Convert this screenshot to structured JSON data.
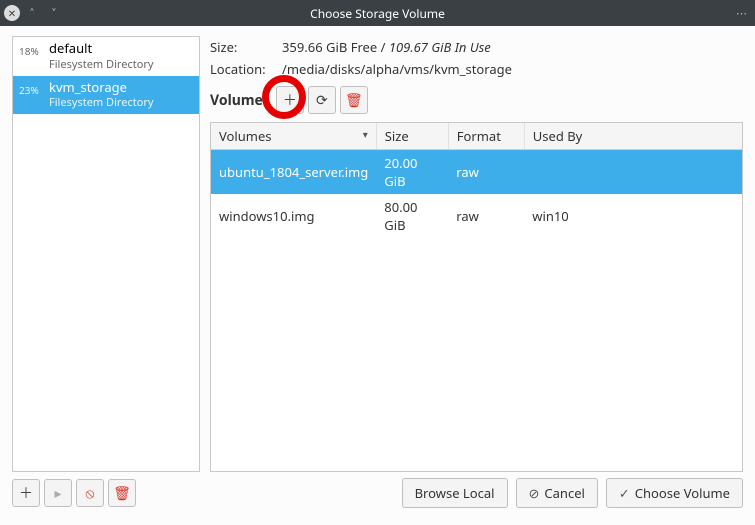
{
  "window": {
    "title": "Choose Storage Volume"
  },
  "sidebar": {
    "pools": [
      {
        "pct": "18%",
        "name": "default",
        "type": "Filesystem Directory",
        "selected": false
      },
      {
        "pct": "23%",
        "name": "kvm_storage",
        "type": "Filesystem Directory",
        "selected": true
      }
    ]
  },
  "details": {
    "size_label": "Size:",
    "size_free": "359.66 GiB Free",
    "size_sep": " / ",
    "size_inuse": "109.67 GiB In Use",
    "location_label": "Location:",
    "location_value": "/media/disks/alpha/vms/kvm_storage",
    "volumes_label": "Volumes"
  },
  "table": {
    "headers": {
      "volumes": "Volumes",
      "size": "Size",
      "format": "Format",
      "usedby": "Used By"
    },
    "rows": [
      {
        "name": "ubuntu_1804_server.img",
        "size": "20.00 GiB",
        "format": "raw",
        "usedby": "",
        "selected": true
      },
      {
        "name": "windows10.img",
        "size": "80.00 GiB",
        "format": "raw",
        "usedby": "win10",
        "selected": false
      }
    ]
  },
  "buttons": {
    "browse_local": "Browse Local",
    "cancel": "Cancel",
    "choose_volume": "Choose Volume"
  },
  "icons": {
    "plus": "＋",
    "refresh": "⟳",
    "trash": "🗑",
    "play": "▸",
    "stop": "⦸",
    "close": "✕",
    "up": "˄",
    "down": "˅",
    "prohibit": "⊘",
    "check": "✓"
  }
}
